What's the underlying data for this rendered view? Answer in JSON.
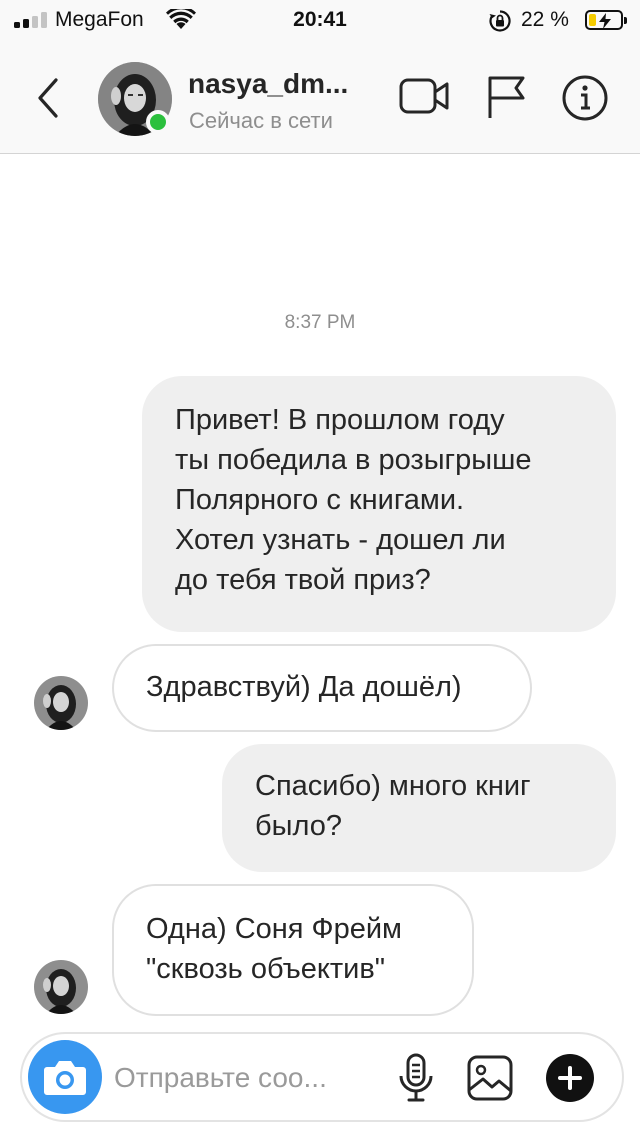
{
  "status_bar": {
    "carrier": "MegaFon",
    "time": "20:41",
    "battery_percent": "22 %",
    "battery_level": 0.22,
    "signal_bars_active": 2,
    "icons": [
      "signal-bars-icon",
      "wifi-icon",
      "rotation-lock-icon",
      "battery-charging-icon"
    ]
  },
  "header": {
    "username": "nasya_dm...",
    "status": "Сейчас в сети",
    "online": true,
    "icons": [
      "back-chevron-icon",
      "video-call-icon",
      "flag-icon",
      "info-icon"
    ]
  },
  "conversation": {
    "timestamp": "8:37 PM",
    "messages": [
      {
        "direction": "outgoing",
        "text": "Привет! В прошлом году\nты победила в розыгрыше\nПолярного с книгами.\nХотел узнать - дошел ли\nдо тебя твой приз?"
      },
      {
        "direction": "incoming",
        "text": "Здравствуй) Да дошёл)"
      },
      {
        "direction": "outgoing",
        "text": "Спасибо) много книг\nбыло?"
      },
      {
        "direction": "incoming",
        "text": "Одна) Соня Фрейм\n\"сквозь объектив\""
      }
    ]
  },
  "composer": {
    "placeholder": "Отправьте соо...",
    "value": "",
    "icons": [
      "camera-icon",
      "microphone-icon",
      "gallery-icon",
      "plus-icon"
    ]
  },
  "colors": {
    "accent_blue": "#3897f0",
    "online_green": "#2bc03d",
    "battery_yellow": "#f5cc00",
    "outgoing_bubble": "#efefef",
    "plus_button": "#111111"
  }
}
